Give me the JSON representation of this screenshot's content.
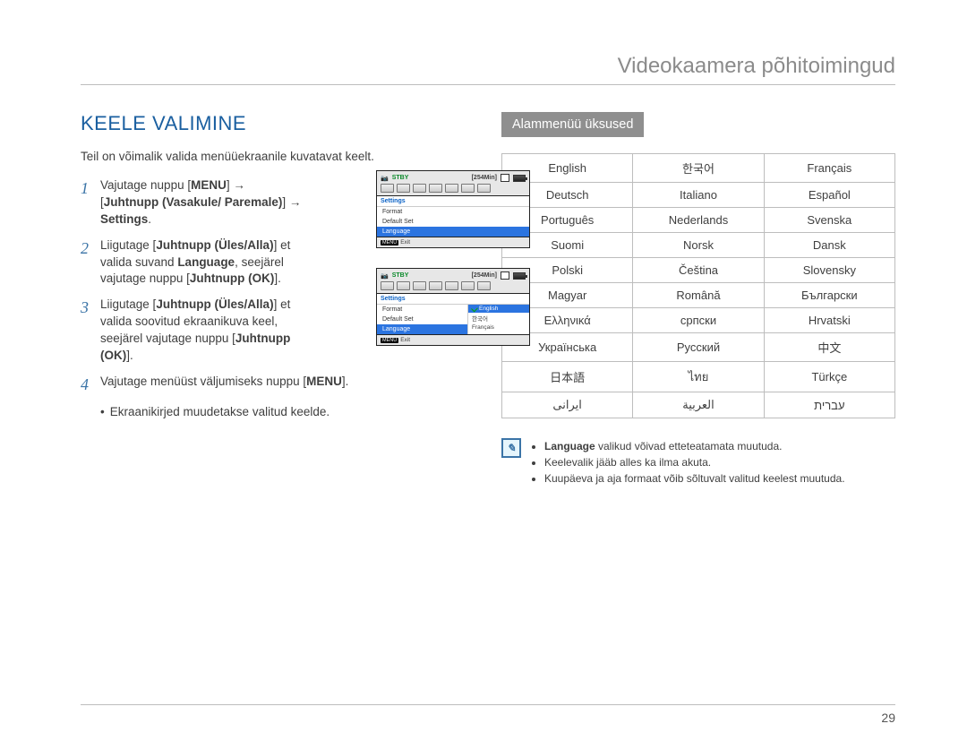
{
  "header": {
    "breadcrumb": "Videokaamera põhitoimingud"
  },
  "title": "KEELE VALIMINE",
  "intro": "Teil on võimalik valida menüüekraanile kuvatavat keelt.",
  "steps": {
    "1": {
      "num": "1",
      "t1": "Vajutage nuppu [",
      "b1": "MENU",
      "t2": "] → [",
      "b2": "Juhtnupp (Vasakule/ Paremale)",
      "t3": "] → ",
      "b3": "Settings",
      "t4": "."
    },
    "2": {
      "num": "2",
      "t1": "Liigutage [",
      "b1": "Juhtnupp (Üles/Alla)",
      "t2": "] et valida suvand ",
      "b2": "Language",
      "t3": ", seejärel vajutage nuppu [",
      "b3": "Juhtnupp (OK)",
      "t4": "]."
    },
    "3": {
      "num": "3",
      "t1": "Liigutage [",
      "b1": "Juhtnupp (Üles/Alla)",
      "t2": "] et valida soovitud ekraanikuva keel, seejärel vajutage nuppu [",
      "b2": "Juhtnupp (OK)",
      "t3": "]."
    },
    "4": {
      "num": "4",
      "t1": "Vajutage menüüst väljumiseks nuppu [",
      "b1": "MENU",
      "t2": "]."
    },
    "bullet": "Ekraanikirjed muudetakse valitud keelde."
  },
  "osd": {
    "stby": "STBY",
    "rec_time": "[254Min]",
    "menu_head": "Settings",
    "items": {
      "format": "Format",
      "default": "Default Set",
      "language": "Language"
    },
    "submenu": {
      "english": "English",
      "korean": "한국어",
      "francais": "Français"
    },
    "exit_btn": "MENU",
    "exit_text": "Exit"
  },
  "submenu_header": "Alammenüü üksused",
  "languages": [
    [
      "English",
      "한국어",
      "Français"
    ],
    [
      "Deutsch",
      "Italiano",
      "Español"
    ],
    [
      "Português",
      "Nederlands",
      "Svenska"
    ],
    [
      "Suomi",
      "Norsk",
      "Dansk"
    ],
    [
      "Polski",
      "Čeština",
      "Slovensky"
    ],
    [
      "Magyar",
      "Română",
      "Български"
    ],
    [
      "Ελληνικά",
      "српски",
      "Hrvatski"
    ],
    [
      "Українська",
      "Русский",
      "中文"
    ],
    [
      "日本語",
      "ไทย",
      "Türkçe"
    ],
    [
      "ایرانی",
      "العربیة",
      "עברית"
    ]
  ],
  "notes": {
    "n1a": "Language",
    "n1b": " valikud võivad etteteatamata muutuda.",
    "n2": "Keelevalik jääb alles ka ilma akuta.",
    "n3": "Kuupäeva ja aja formaat võib sõltuvalt valitud keelest muutuda."
  },
  "page_number": "29"
}
